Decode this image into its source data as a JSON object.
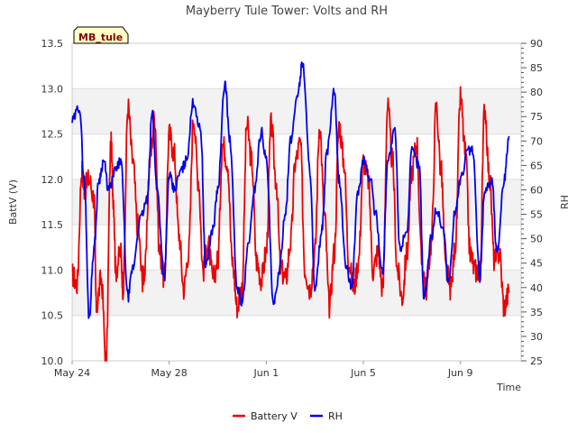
{
  "chart_data": {
    "type": "line",
    "title": "Mayberry Tule Tower: Volts and RH",
    "station_label": "MB_tule",
    "xlabel": "Time",
    "ylabel_left": "BattV (V)",
    "ylabel_right": "RH",
    "x_ticks": [
      "May 24",
      "May 28",
      "Jun 1",
      "Jun 5",
      "Jun 9"
    ],
    "x_tick_days": [
      0,
      4,
      8,
      12,
      16
    ],
    "x_range_days": [
      0,
      18.5
    ],
    "ylim_left": [
      10.0,
      13.5
    ],
    "y_ticks_left": [
      "10.0",
      "10.5",
      "11.0",
      "11.5",
      "12.0",
      "12.5",
      "13.0",
      "13.5"
    ],
    "ylim_right": [
      25,
      90
    ],
    "y_ticks_right": [
      "25",
      "30",
      "35",
      "40",
      "45",
      "50",
      "55",
      "60",
      "65",
      "70",
      "75",
      "80",
      "85",
      "90"
    ],
    "grid": true,
    "legend_position": "bottom",
    "series": [
      {
        "name": "Battery V",
        "color": "#ee0000",
        "axis": "left",
        "x_days": [
          0.0,
          0.2,
          0.4,
          0.5,
          0.7,
          0.9,
          1.0,
          1.2,
          1.4,
          1.6,
          1.7,
          1.8,
          2.0,
          2.1,
          2.3,
          2.5,
          2.7,
          2.9,
          3.0,
          3.2,
          3.4,
          3.6,
          3.8,
          4.0,
          4.2,
          4.4,
          4.6,
          4.8,
          5.0,
          5.2,
          5.4,
          5.6,
          5.8,
          6.0,
          6.2,
          6.4,
          6.6,
          6.8,
          7.0,
          7.2,
          7.4,
          7.6,
          7.8,
          8.0,
          8.2,
          8.4,
          8.6,
          8.8,
          9.0,
          9.2,
          9.4,
          9.6,
          9.8,
          10.0,
          10.2,
          10.4,
          10.6,
          10.8,
          11.0,
          11.2,
          11.4,
          11.6,
          11.8,
          12.0,
          12.2,
          12.4,
          12.6,
          12.8,
          13.0,
          13.2,
          13.4,
          13.6,
          13.8,
          14.0,
          14.2,
          14.4,
          14.6,
          14.8,
          15.0,
          15.2,
          15.4,
          15.6,
          15.8,
          16.0,
          16.2,
          16.4,
          16.6,
          16.8,
          17.0,
          17.2,
          17.4,
          17.6,
          17.8,
          18.0
        ],
        "values": [
          10.95,
          10.85,
          12.1,
          11.9,
          12.0,
          11.8,
          10.6,
          10.9,
          10.0,
          12.4,
          11.8,
          11.0,
          11.2,
          10.8,
          12.8,
          12.2,
          11.5,
          10.9,
          11.0,
          12.2,
          12.7,
          11.2,
          10.9,
          12.5,
          12.3,
          11.4,
          10.8,
          11.2,
          12.7,
          12.0,
          11.0,
          11.3,
          10.9,
          11.1,
          12.4,
          12.2,
          11.1,
          10.6,
          10.8,
          12.6,
          12.2,
          11.1,
          10.9,
          11.2,
          12.6,
          12.0,
          11.0,
          10.9,
          11.3,
          12.2,
          12.4,
          11.0,
          10.8,
          11.2,
          12.6,
          11.6,
          10.6,
          11.2,
          12.6,
          12.2,
          11.1,
          10.8,
          11.1,
          12.2,
          12.0,
          11.0,
          11.2,
          10.8,
          12.8,
          12.2,
          11.0,
          10.7,
          11.2,
          12.1,
          12.4,
          11.1,
          10.8,
          11.3,
          12.8,
          12.1,
          11.0,
          10.8,
          11.3,
          12.9,
          12.3,
          11.2,
          11.0,
          11.0,
          12.8,
          12.0,
          11.1,
          11.2,
          10.6,
          10.75
        ]
      },
      {
        "name": "RH",
        "color": "#0000ee",
        "axis": "right",
        "x_days": [
          0.0,
          0.3,
          0.5,
          0.7,
          0.9,
          1.1,
          1.3,
          1.5,
          1.8,
          2.0,
          2.3,
          2.5,
          2.8,
          3.1,
          3.3,
          3.5,
          3.8,
          4.0,
          4.2,
          4.5,
          4.7,
          5.0,
          5.3,
          5.5,
          5.8,
          6.0,
          6.3,
          6.5,
          6.8,
          7.0,
          7.3,
          7.5,
          7.8,
          8.0,
          8.3,
          8.5,
          8.8,
          9.0,
          9.3,
          9.5,
          9.8,
          10.0,
          10.3,
          10.5,
          10.8,
          11.0,
          11.3,
          11.5,
          11.8,
          12.0,
          12.3,
          12.5,
          12.8,
          13.0,
          13.3,
          13.5,
          13.8,
          14.0,
          14.3,
          14.5,
          14.8,
          15.0,
          15.3,
          15.5,
          15.8,
          16.0,
          16.3,
          16.5,
          16.8,
          17.0,
          17.3,
          17.5,
          17.8,
          18.0
        ],
        "values": [
          74,
          77,
          62,
          34,
          48,
          62,
          66,
          60,
          64,
          66,
          38,
          44,
          54,
          58,
          76,
          60,
          42,
          63,
          60,
          64,
          66,
          78,
          72,
          44,
          52,
          60,
          82,
          70,
          40,
          37,
          50,
          60,
          72,
          66,
          36,
          42,
          56,
          70,
          80,
          86,
          64,
          39,
          52,
          68,
          80,
          62,
          44,
          40,
          60,
          66,
          62,
          55,
          43,
          66,
          72,
          48,
          52,
          68,
          65,
          38,
          50,
          56,
          52,
          41,
          56,
          62,
          68,
          68,
          42,
          60,
          62,
          47,
          62,
          71
        ]
      }
    ]
  }
}
